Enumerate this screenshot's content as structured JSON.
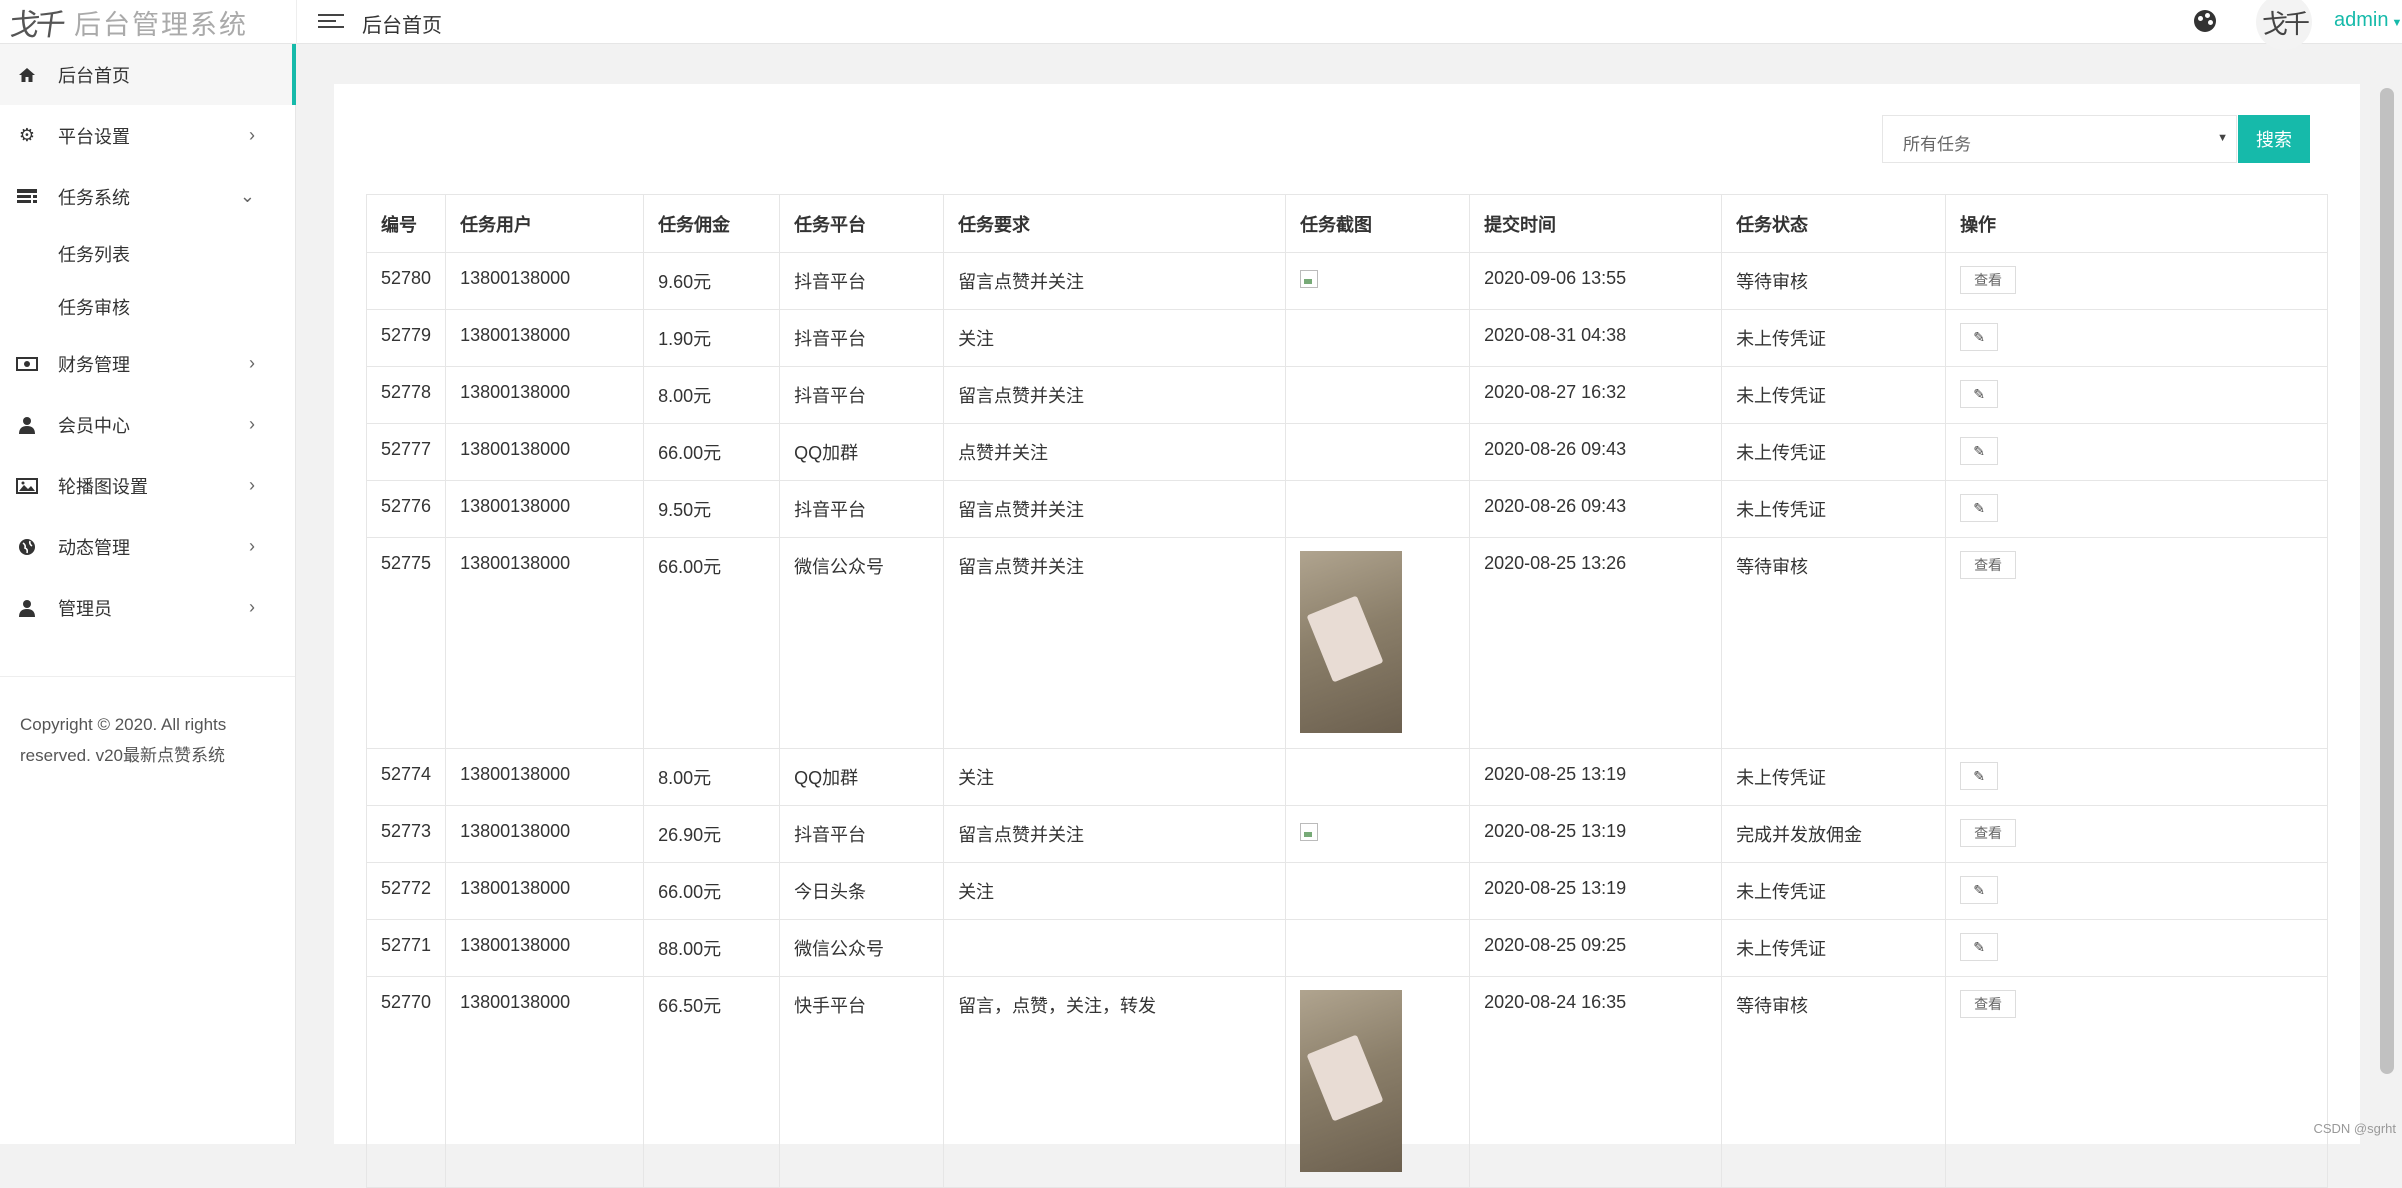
{
  "app": {
    "logo_mark": "戈千",
    "title": "后台管理系统",
    "breadcrumb": "后台首页",
    "user": "admin",
    "avatar_mark": "戈千",
    "accent_color": "#16baaa"
  },
  "sidebar": {
    "items": [
      {
        "label": "后台首页",
        "icon": "home-icon",
        "active": true
      },
      {
        "label": "平台设置",
        "icon": "gear-icon",
        "arrow": "›"
      },
      {
        "label": "任务系统",
        "icon": "list-icon",
        "arrow": "⌄"
      },
      {
        "label": "任务列表",
        "sub": true
      },
      {
        "label": "任务审核",
        "sub": true
      },
      {
        "label": "财务管理",
        "icon": "money-icon",
        "arrow": "›"
      },
      {
        "label": "会员中心",
        "icon": "user-icon",
        "arrow": "›"
      },
      {
        "label": "轮播图设置",
        "icon": "image-icon",
        "arrow": "›"
      },
      {
        "label": "动态管理",
        "icon": "globe-icon",
        "arrow": "›"
      },
      {
        "label": "管理员",
        "icon": "admin-user-icon",
        "arrow": "›"
      }
    ],
    "copyright_line1": "Copyright © 2020. All rights",
    "copyright_line2": "reserved. v20最新点赞系统"
  },
  "filter": {
    "select_value": "所有任务",
    "search_label": "搜索"
  },
  "table": {
    "headers": [
      "编号",
      "任务用户",
      "任务佣金",
      "任务平台",
      "任务要求",
      "任务截图",
      "提交时间",
      "任务状态",
      "操作"
    ],
    "view_label": "查看",
    "edit_label": "✎",
    "rows": [
      {
        "id": "52780",
        "user": "13800138000",
        "fee": "9.60元",
        "platform": "抖音平台",
        "req": "留言点赞并关注",
        "shot": "broken",
        "time": "2020-09-06 13:55",
        "status": "等待审核",
        "action": "view"
      },
      {
        "id": "52779",
        "user": "13800138000",
        "fee": "1.90元",
        "platform": "抖音平台",
        "req": "关注",
        "shot": "",
        "time": "2020-08-31 04:38",
        "status": "未上传凭证",
        "action": "edit"
      },
      {
        "id": "52778",
        "user": "13800138000",
        "fee": "8.00元",
        "platform": "抖音平台",
        "req": "留言点赞并关注",
        "shot": "",
        "time": "2020-08-27 16:32",
        "status": "未上传凭证",
        "action": "edit"
      },
      {
        "id": "52777",
        "user": "13800138000",
        "fee": "66.00元",
        "platform": "QQ加群",
        "req": "点赞并关注",
        "shot": "",
        "time": "2020-08-26 09:43",
        "status": "未上传凭证",
        "action": "edit"
      },
      {
        "id": "52776",
        "user": "13800138000",
        "fee": "9.50元",
        "platform": "抖音平台",
        "req": "留言点赞并关注",
        "shot": "",
        "time": "2020-08-26 09:43",
        "status": "未上传凭证",
        "action": "edit"
      },
      {
        "id": "52775",
        "user": "13800138000",
        "fee": "66.00元",
        "platform": "微信公众号",
        "req": "留言点赞并关注",
        "shot": "photo",
        "time": "2020-08-25 13:26",
        "status": "等待审核",
        "action": "view"
      },
      {
        "id": "52774",
        "user": "13800138000",
        "fee": "8.00元",
        "platform": "QQ加群",
        "req": "关注",
        "shot": "",
        "time": "2020-08-25 13:19",
        "status": "未上传凭证",
        "action": "edit"
      },
      {
        "id": "52773",
        "user": "13800138000",
        "fee": "26.90元",
        "platform": "抖音平台",
        "req": "留言点赞并关注",
        "shot": "broken",
        "time": "2020-08-25 13:19",
        "status": "完成并发放佣金",
        "action": "view"
      },
      {
        "id": "52772",
        "user": "13800138000",
        "fee": "66.00元",
        "platform": "今日头条",
        "req": "关注",
        "shot": "",
        "time": "2020-08-25 13:19",
        "status": "未上传凭证",
        "action": "edit"
      },
      {
        "id": "52771",
        "user": "13800138000",
        "fee": "88.00元",
        "platform": "微信公众号",
        "req": "",
        "shot": "",
        "time": "2020-08-25 09:25",
        "status": "未上传凭证",
        "action": "edit"
      },
      {
        "id": "52770",
        "user": "13800138000",
        "fee": "66.50元",
        "platform": "快手平台",
        "req": "留言，点赞，关注，转发",
        "shot": "photo",
        "time": "2020-08-24 16:35",
        "status": "等待审核",
        "action": "view"
      }
    ]
  },
  "watermark": "CSDN @sgrht"
}
